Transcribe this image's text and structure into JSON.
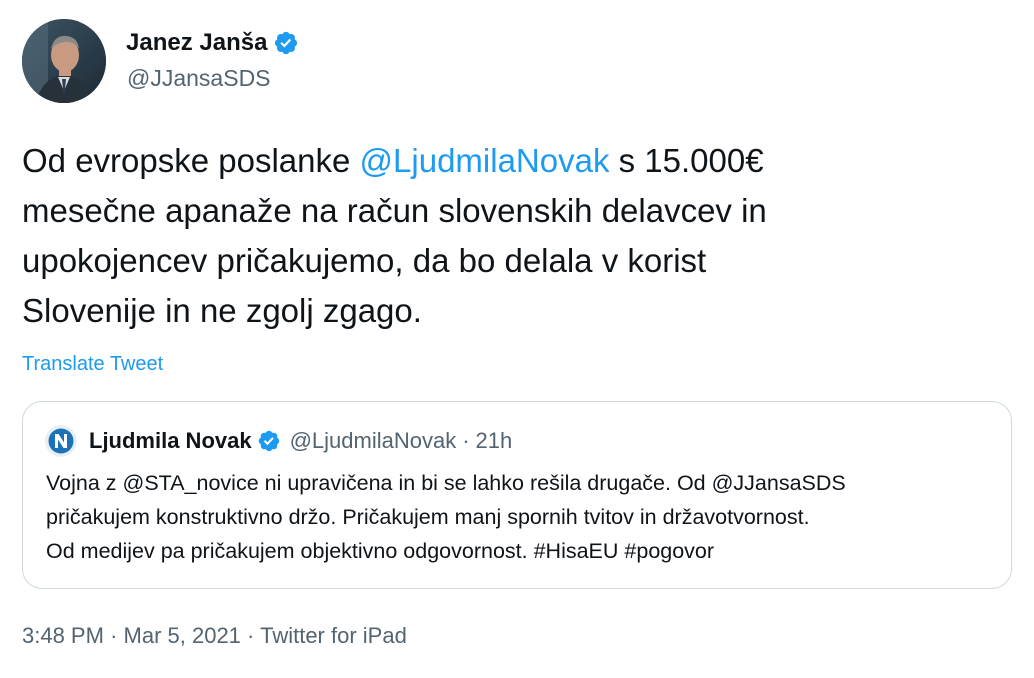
{
  "tweet": {
    "author": {
      "name": "Janez Janša",
      "handle": "@JJansaSDS",
      "verified": true
    },
    "text_lines": [
      {
        "before": "Od evropske poslanke ",
        "mention": "@LjudmilaNovak",
        "after": " s 15.000€"
      },
      {
        "text": "mesečne apanaže na račun slovenskih delavcev in"
      },
      {
        "text": "upokojencev pričakujemo, da bo delala v korist"
      },
      {
        "text": "Slovenije in ne zgolj zgago."
      }
    ],
    "translate_label": "Translate Tweet",
    "meta": {
      "time": "3:48 PM",
      "separator": "·",
      "date": "Mar 5, 2021",
      "source": "Twitter for iPad"
    }
  },
  "quoted_tweet": {
    "author": {
      "name": "Ljudmila Novak",
      "handle": "@LjudmilaNovak",
      "verified": true
    },
    "separator": "·",
    "time": "21h",
    "text_lines": [
      "Vojna z @STA_novice ni upravičena in bi se lahko rešila drugače. Od @JJansaSDS",
      "pričakujem konstruktivno držo. Pričakujem manj spornih tvitov in državotvornost.",
      "Od medijev pa pričakujem objektivno odgovornost. #HisaEU #pogovor"
    ]
  },
  "colors": {
    "accent": "#1d9bf0",
    "text_primary": "#0f1419",
    "text_secondary": "#536471",
    "border": "#cfd9de"
  },
  "icons": {
    "verified": "verified-badge-icon",
    "quote_avatar": "nsi-logo-avatar"
  }
}
